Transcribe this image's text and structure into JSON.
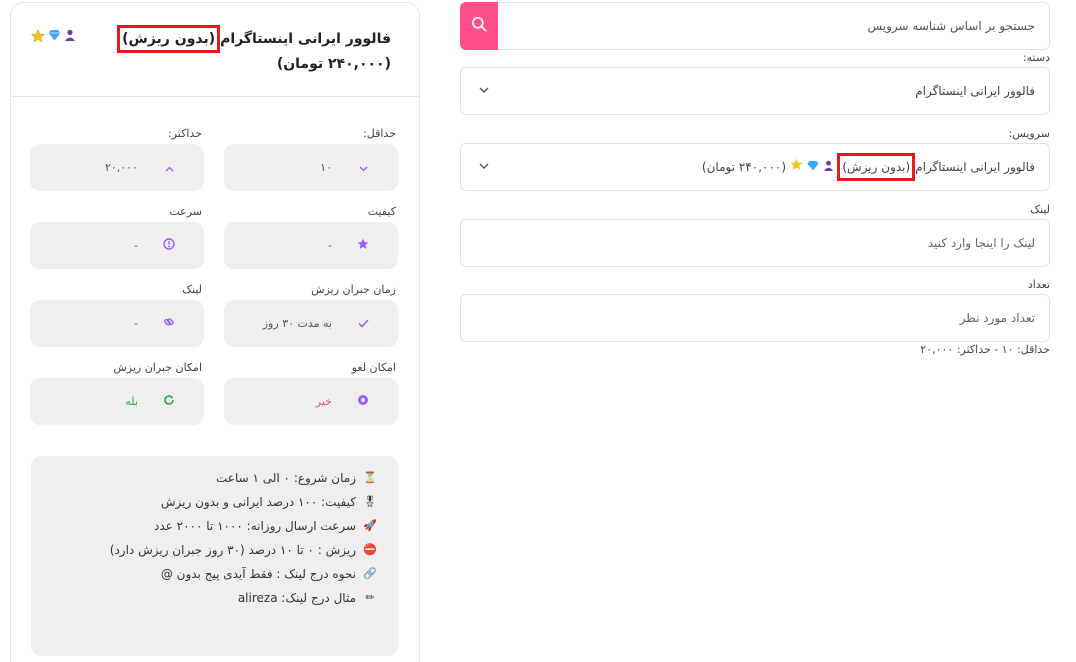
{
  "card": {
    "title_before": "فالوور ایرانی اینستاگرام",
    "title_highlight": "(بدون ریزش)",
    "title_after": "(۲۴۰,۰۰۰ تومان)",
    "icons": [
      "person-icon",
      "diamond-icon",
      "star-icon"
    ],
    "fields": [
      {
        "label": "حداقل:",
        "value": "۱۰",
        "icon": "chevron-down-icon"
      },
      {
        "label": "حداکثر:",
        "value": "۲۰,۰۰۰",
        "icon": "chevron-up-icon"
      },
      {
        "label": "کیفیت",
        "value": "-",
        "icon": "star-icon"
      },
      {
        "label": "سرعت",
        "value": "-",
        "icon": "speed-icon"
      },
      {
        "label": "زمان جبران ریزش",
        "value": "به مدت ۳۰ روز",
        "icon": "check-icon"
      },
      {
        "label": "لینک",
        "value": "-",
        "icon": "link-icon"
      },
      {
        "label": "امکان لغو",
        "value": "خیر",
        "icon": "circle-dot-icon"
      },
      {
        "label": "امکان جبران ریزش",
        "value": "بله",
        "icon": "refresh-icon"
      }
    ],
    "description": [
      {
        "emoji": "⏳",
        "text": "زمان شروع: ۰ الی ۱ ساعت"
      },
      {
        "emoji": "🎖",
        "text": "کیفیت: ۱۰۰ درصد ایرانی و بدون ریزش"
      },
      {
        "emoji": "🚀",
        "text": "سرعت ارسال روزانه: ۱۰۰۰ تا ۲۰۰۰ عدد"
      },
      {
        "emoji": "⛔",
        "text": "ریزش : ۰ تا ۱۰ درصد (۳۰ روز جبران ریزش دارد)"
      },
      {
        "emoji": "🔗",
        "text": "نحوه درج لینک : فقط آیدی پیج بدون @"
      },
      {
        "emoji": "✏",
        "text": "مثال درج لینک: alireza"
      }
    ]
  },
  "form": {
    "search_placeholder": "جستجو بر اساس شناسه سرویس",
    "category_label": "دسته:",
    "category_value": "فالوور ایرانی اینستاگرام",
    "service_label": "سرویس:",
    "service_before": "فالوور ایرانی اینستاگرام",
    "service_highlight": "(بدون ریزش)",
    "service_after": "(۲۴۰,۰۰۰ تومان)",
    "link_label": "لینک",
    "link_placeholder": "لینک را اینجا وارد کنید",
    "quantity_label": "تعداد",
    "quantity_placeholder": "تعداد مورد نظر",
    "quantity_hint": "حداقل: ۱۰ - حداکثر: ۲۰,۰۰۰"
  },
  "colors": {
    "accent": "#ff4f8b",
    "purple": "#9b59ff",
    "highlight_border": "#e01e1e",
    "no_red": "#e35a5a",
    "yes_green": "#2eaa4a"
  }
}
